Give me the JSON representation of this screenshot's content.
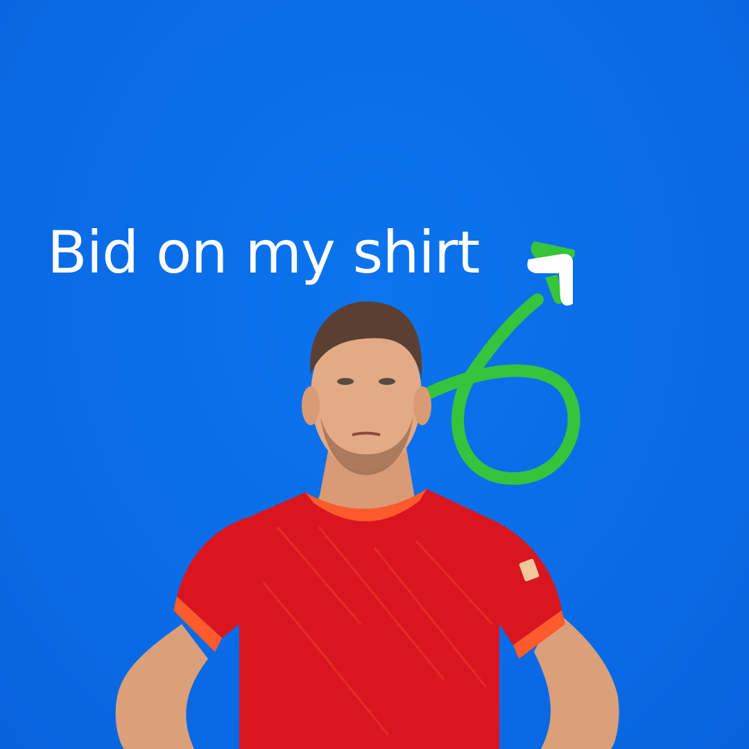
{
  "headline": "Bid on my shirt",
  "graphics": {
    "arrow_icon": "upward-loop-arrow-icon",
    "person": "footballer-in-red-shirt-photo",
    "shirt_badge": "shirt-sponsor-badge-icon"
  },
  "colors": {
    "background": "#0a6fe8",
    "headline": "#ffffff",
    "arrow_green": "#35c43c",
    "arrow_head_white": "#ffffff",
    "shirt_red": "#d9161f",
    "collar_orange": "#ff5a2b"
  }
}
